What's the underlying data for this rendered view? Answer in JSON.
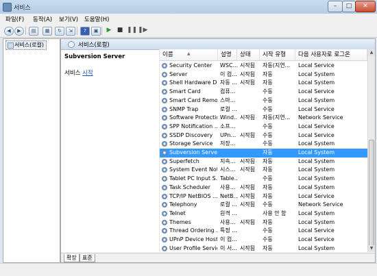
{
  "window": {
    "title": "서비스",
    "min": "–",
    "max": "□",
    "close": "✕"
  },
  "menu": [
    "파일(F)",
    "동작(A)",
    "보기(V)",
    "도움말(H)"
  ],
  "toolbar": {
    "icons": [
      "back-icon",
      "forward-icon",
      "show-tree-icon",
      "properties-icon",
      "refresh-icon",
      "export-icon",
      "help-icon",
      "console-icon",
      "start-icon",
      "stop-icon",
      "pause-icon",
      "restart-icon"
    ]
  },
  "tree": {
    "root": "서비스(로컬)"
  },
  "pane": {
    "header": "서비스(로컬)",
    "selected_name": "Subversion Server",
    "service_label": "서비스",
    "start_link": "시작"
  },
  "columns": [
    "이름",
    "설명",
    "상태",
    "시작 유형",
    "다음 사용자로 로그온"
  ],
  "rows": [
    {
      "name": "Security Center",
      "desc": "WSC...",
      "status": "시작됨",
      "startup": "자동(지연...",
      "logon": "Local Service"
    },
    {
      "name": "Server",
      "desc": "이 컴...",
      "status": "시작됨",
      "startup": "자동",
      "logon": "Local System"
    },
    {
      "name": "Shell Hardware D...",
      "desc": "자동 ...",
      "status": "시작됨",
      "startup": "자동",
      "logon": "Local System"
    },
    {
      "name": "Smart Card",
      "desc": "컴퓨...",
      "status": "",
      "startup": "수동",
      "logon": "Local Service"
    },
    {
      "name": "Smart Card Remo...",
      "desc": "스마...",
      "status": "",
      "startup": "수동",
      "logon": "Local System"
    },
    {
      "name": "SNMP Trap",
      "desc": "로컬 ...",
      "status": "",
      "startup": "수동",
      "logon": "Local Service"
    },
    {
      "name": "Software Protection",
      "desc": "Wind...",
      "status": "시작됨",
      "startup": "자동(지연...",
      "logon": "Network Service"
    },
    {
      "name": "SPP Notification ...",
      "desc": "소프...",
      "status": "",
      "startup": "수동",
      "logon": "Local Service"
    },
    {
      "name": "SSDP Discovery",
      "desc": "UPn...",
      "status": "시작됨",
      "startup": "수동",
      "logon": "Local Service"
    },
    {
      "name": "Storage Service",
      "desc": "저장...",
      "status": "",
      "startup": "수동",
      "logon": "Local System"
    },
    {
      "name": "Subversion Server",
      "desc": "",
      "status": "",
      "startup": "자동",
      "logon": "Local System"
    },
    {
      "name": "Superfetch",
      "desc": "지속...",
      "status": "시작됨",
      "startup": "자동",
      "logon": "Local System"
    },
    {
      "name": "System Event Not...",
      "desc": "시스...",
      "status": "시작됨",
      "startup": "자동",
      "logon": "Local System"
    },
    {
      "name": "Tablet PC Input S...",
      "desc": "Table...",
      "status": "",
      "startup": "수동",
      "logon": "Local System"
    },
    {
      "name": "Task Scheduler",
      "desc": "사용...",
      "status": "시작됨",
      "startup": "자동",
      "logon": "Local System"
    },
    {
      "name": "TCP/IP NetBIOS ...",
      "desc": "NetB...",
      "status": "시작됨",
      "startup": "자동",
      "logon": "Local Service"
    },
    {
      "name": "Telephony",
      "desc": "로컬 ...",
      "status": "시작됨",
      "startup": "수동",
      "logon": "Network Service"
    },
    {
      "name": "Telnet",
      "desc": "원격 ...",
      "status": "",
      "startup": "사용 안 함",
      "logon": "Local System"
    },
    {
      "name": "Themes",
      "desc": "사용...",
      "status": "시작됨",
      "startup": "자동",
      "logon": "Local System"
    },
    {
      "name": "Thread Ordering ...",
      "desc": "특정 ...",
      "status": "",
      "startup": "수동",
      "logon": "Local Service"
    },
    {
      "name": "UPnP Device Host",
      "desc": "이 컴...",
      "status": "",
      "startup": "수동",
      "logon": "Local Service"
    },
    {
      "name": "User Profile Service",
      "desc": "이 서...",
      "status": "시작됨",
      "startup": "자동",
      "logon": "Local System"
    }
  ],
  "selected_row": "Subversion Server",
  "tabs": [
    "확장",
    "표준"
  ],
  "colors": {
    "selection": "#3399ff",
    "link": "#1a55b8"
  }
}
